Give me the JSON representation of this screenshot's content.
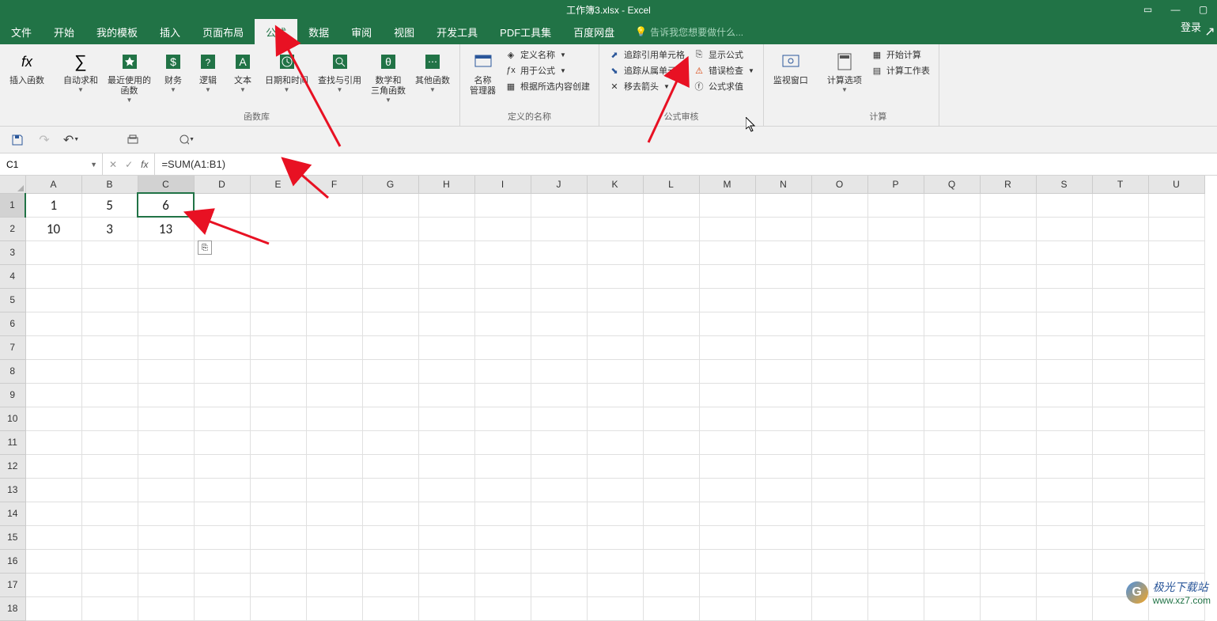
{
  "app": {
    "title": "工作簿3.xlsx - Excel",
    "login": "登录"
  },
  "tabs": {
    "file": "文件",
    "home": "开始",
    "my_templates": "我的模板",
    "insert": "插入",
    "page_layout": "页面布局",
    "formulas": "公式",
    "data": "数据",
    "review": "审阅",
    "view": "视图",
    "developer": "开发工具",
    "pdf_tools": "PDF工具集",
    "baidu_disk": "百度网盘",
    "tell_me": "告诉我您想要做什么..."
  },
  "ribbon": {
    "insert_function": "插入函数",
    "autosum": "自动求和",
    "recently_used": "最近使用的\n函数",
    "financial": "财务",
    "logical": "逻辑",
    "text": "文本",
    "date_time": "日期和时间",
    "lookup_ref": "查找与引用",
    "math_trig": "数学和\n三角函数",
    "more_functions": "其他函数",
    "group_function_lib": "函数库",
    "name_manager": "名称\n管理器",
    "define_name": "定义名称",
    "use_in_formula": "用于公式",
    "create_from_sel": "根据所选内容创建",
    "group_defined_names": "定义的名称",
    "trace_precedents": "追踪引用单元格",
    "trace_dependents": "追踪从属单元格",
    "remove_arrows": "移去箭头",
    "show_formulas": "显示公式",
    "error_checking": "错误检查",
    "evaluate_formula": "公式求值",
    "group_formula_auditing": "公式审核",
    "watch_window": "监视窗口",
    "calc_options": "计算选项",
    "calc_now": "开始计算",
    "calc_sheet": "计算工作表",
    "group_calculation": "计算"
  },
  "formulabar": {
    "name": "C1",
    "formula": "=SUM(A1:B1)"
  },
  "columns": [
    "A",
    "B",
    "C",
    "D",
    "E",
    "F",
    "G",
    "H",
    "I",
    "J",
    "K",
    "L",
    "M",
    "N",
    "O",
    "P",
    "Q",
    "R",
    "S",
    "T",
    "U"
  ],
  "rows": [
    "1",
    "2",
    "3",
    "4",
    "5",
    "6",
    "7",
    "8",
    "9",
    "10",
    "11",
    "12",
    "13",
    "14",
    "15",
    "16",
    "17",
    "18"
  ],
  "cells": {
    "A1": "1",
    "B1": "5",
    "C1": "6",
    "A2": "10",
    "B2": "3",
    "C2": "13"
  },
  "watermark": {
    "text": "极光下载站",
    "url": "www.xz7.com"
  }
}
